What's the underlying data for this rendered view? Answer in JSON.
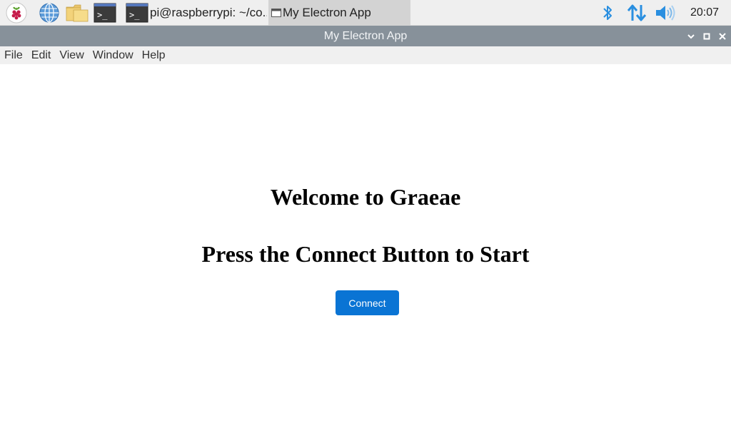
{
  "taskbar": {
    "launchers": [
      {
        "icon": "raspberry-menu-icon"
      },
      {
        "icon": "web-browser-globe-icon"
      },
      {
        "icon": "file-manager-folder-icon"
      },
      {
        "icon": "terminal-icon"
      }
    ],
    "tasks": [
      {
        "icon": "terminal-icon",
        "label": "pi@raspberrypi: ~/co...",
        "active": false
      },
      {
        "icon": "app-window-icon",
        "label": "My Electron App",
        "active": true
      }
    ],
    "tray": {
      "bluetooth_icon": "bluetooth-icon",
      "network_icon": "network-arrows-icon",
      "volume_icon": "volume-icon",
      "accent_color": "#2a8fe0"
    },
    "clock": "20:07"
  },
  "window": {
    "title": "My Electron App",
    "controls": [
      "minimize-chevron-icon",
      "maximize-square-icon",
      "close-x-icon"
    ]
  },
  "menubar": {
    "items": [
      "File",
      "Edit",
      "View",
      "Window",
      "Help"
    ]
  },
  "content": {
    "heading1": "Welcome to Graeae",
    "heading2": "Press the Connect Button to Start",
    "connect_label": "Connect",
    "button_color": "#0a74d4"
  }
}
